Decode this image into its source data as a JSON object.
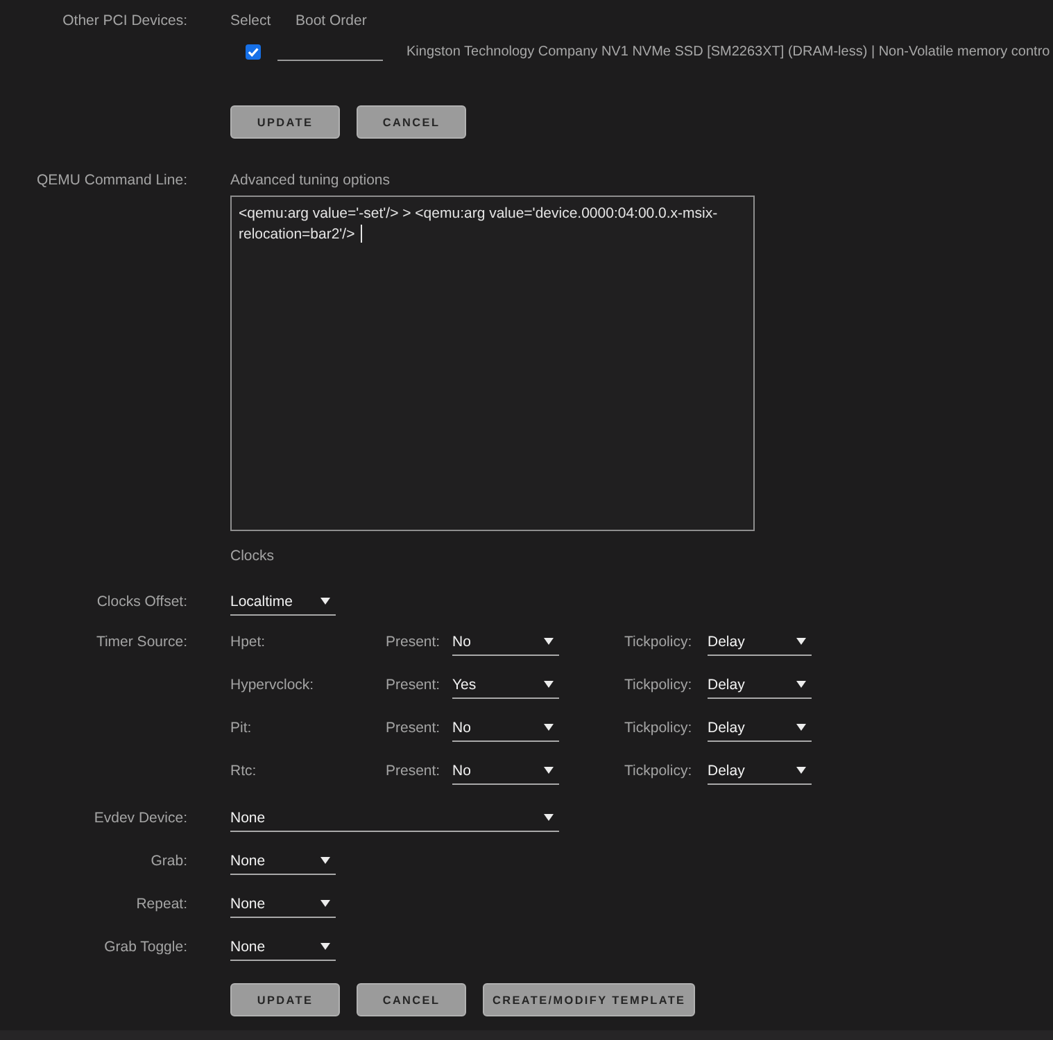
{
  "pci_devices": {
    "label": "Other PCI Devices:",
    "columns": [
      "Select",
      "Boot Order"
    ],
    "devices": [
      {
        "checked": true,
        "name": "Kingston Technology Company NV1 NVMe SSD [SM2263XT] (DRAM-less) | Non-Volatile memory contro"
      }
    ],
    "buttons": [
      "UPDATE",
      "CANCEL"
    ]
  },
  "qemu_command_line": {
    "label": "QEMU Command Line:",
    "caption": "Advanced tuning options",
    "value": "<qemu:arg value='-set'/> > <qemu:arg value='device.0000:04:00.0.x-msix-relocation=bar2'/>",
    "focused": true
  },
  "clocks": {
    "heading": "Clocks",
    "offset": {
      "label": "Clocks Offset:",
      "value": "Localtime"
    },
    "timer_source": {
      "label": "Timer Source:",
      "timers": [
        {
          "name": "Hpet:",
          "present_label": "Present:",
          "present": "No",
          "tickpolicy_label": "Tickpolicy:",
          "tickpolicy": "Delay"
        },
        {
          "name": "Hypervclock:",
          "present_label": "Present:",
          "present": "Yes",
          "tickpolicy_label": "Tickpolicy:",
          "tickpolicy": "Delay"
        },
        {
          "name": "Pit:",
          "present_label": "Present:",
          "present": "No",
          "tickpolicy_label": "Tickpolicy:",
          "tickpolicy": "Delay"
        },
        {
          "name": "Rtc:",
          "present_label": "Present:",
          "present": "No",
          "tickpolicy_label": "Tickpolicy:",
          "tickpolicy": "Delay"
        }
      ]
    }
  },
  "input_devices": [
    {
      "kind": "wide",
      "label": "Evdev Device:",
      "value": "None"
    },
    {
      "kind": "narrow",
      "label": "Grab:",
      "value": "None"
    },
    {
      "kind": "narrow",
      "label": "Repeat:",
      "value": "None"
    },
    {
      "kind": "narrow",
      "label": "Grab Toggle:",
      "value": "None"
    }
  ],
  "buttons": [
    "UPDATE",
    "CANCEL",
    "CREATE/MODIFY TEMPLATE"
  ]
}
